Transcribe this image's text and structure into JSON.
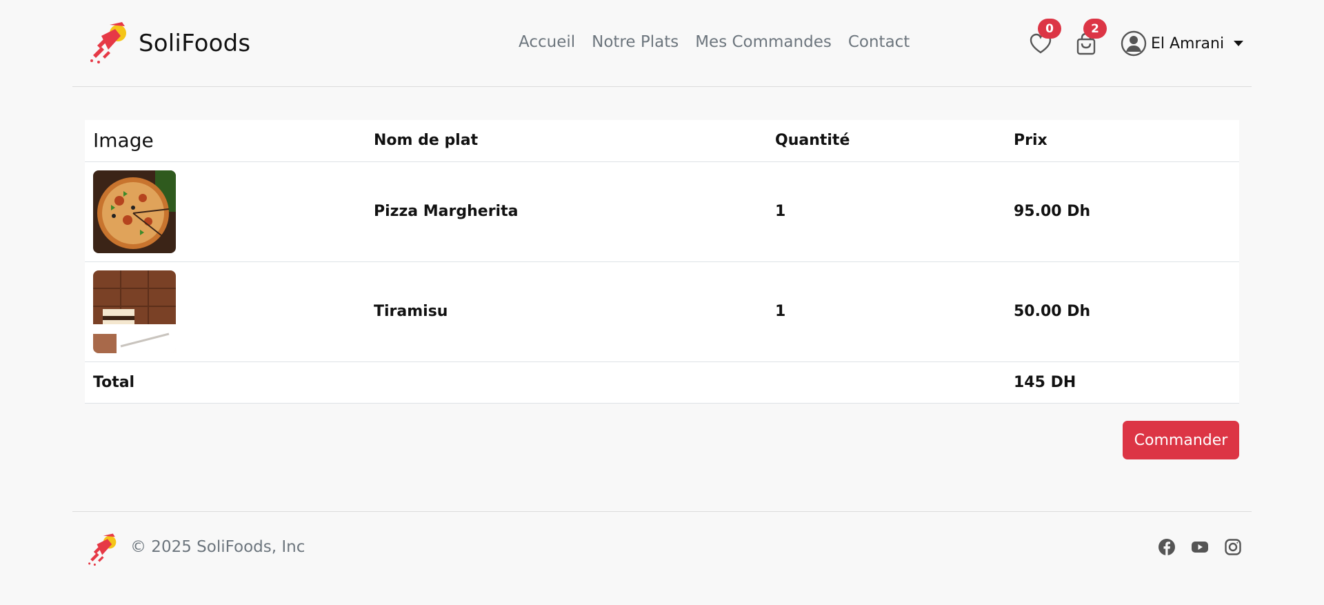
{
  "brand": {
    "name": "SoliFoods",
    "logo_icon": "rocket-food-logo-icon"
  },
  "nav": {
    "items": [
      {
        "label": "Accueil"
      },
      {
        "label": "Notre Plats"
      },
      {
        "label": "Mes Commandes"
      },
      {
        "label": "Contact"
      }
    ]
  },
  "header": {
    "wishlist_count": "0",
    "cart_count": "2",
    "user_name": "El Amrani",
    "icons": [
      "heart-icon",
      "shopping-bag-icon",
      "user-circle-icon",
      "caret-down-icon"
    ]
  },
  "cart": {
    "headers": {
      "image": "Image",
      "name": "Nom de plat",
      "quantity": "Quantité",
      "price": "Prix"
    },
    "items": [
      {
        "name": "Pizza Margherita",
        "quantity": "1",
        "price": "95.00 Dh"
      },
      {
        "name": "Tiramisu",
        "quantity": "1",
        "price": "50.00 Dh"
      }
    ],
    "total_label": "Total",
    "total_value": "145 DH",
    "order_button": "Commander"
  },
  "footer": {
    "copyright": "© 2025 SoliFoods, Inc",
    "socials": [
      "facebook-icon",
      "youtube-icon",
      "instagram-icon"
    ]
  },
  "colors": {
    "accent": "#dc3545",
    "muted_text": "#6c757d",
    "background": "#f8f8f8",
    "logo_yellow": "#f5c518"
  }
}
